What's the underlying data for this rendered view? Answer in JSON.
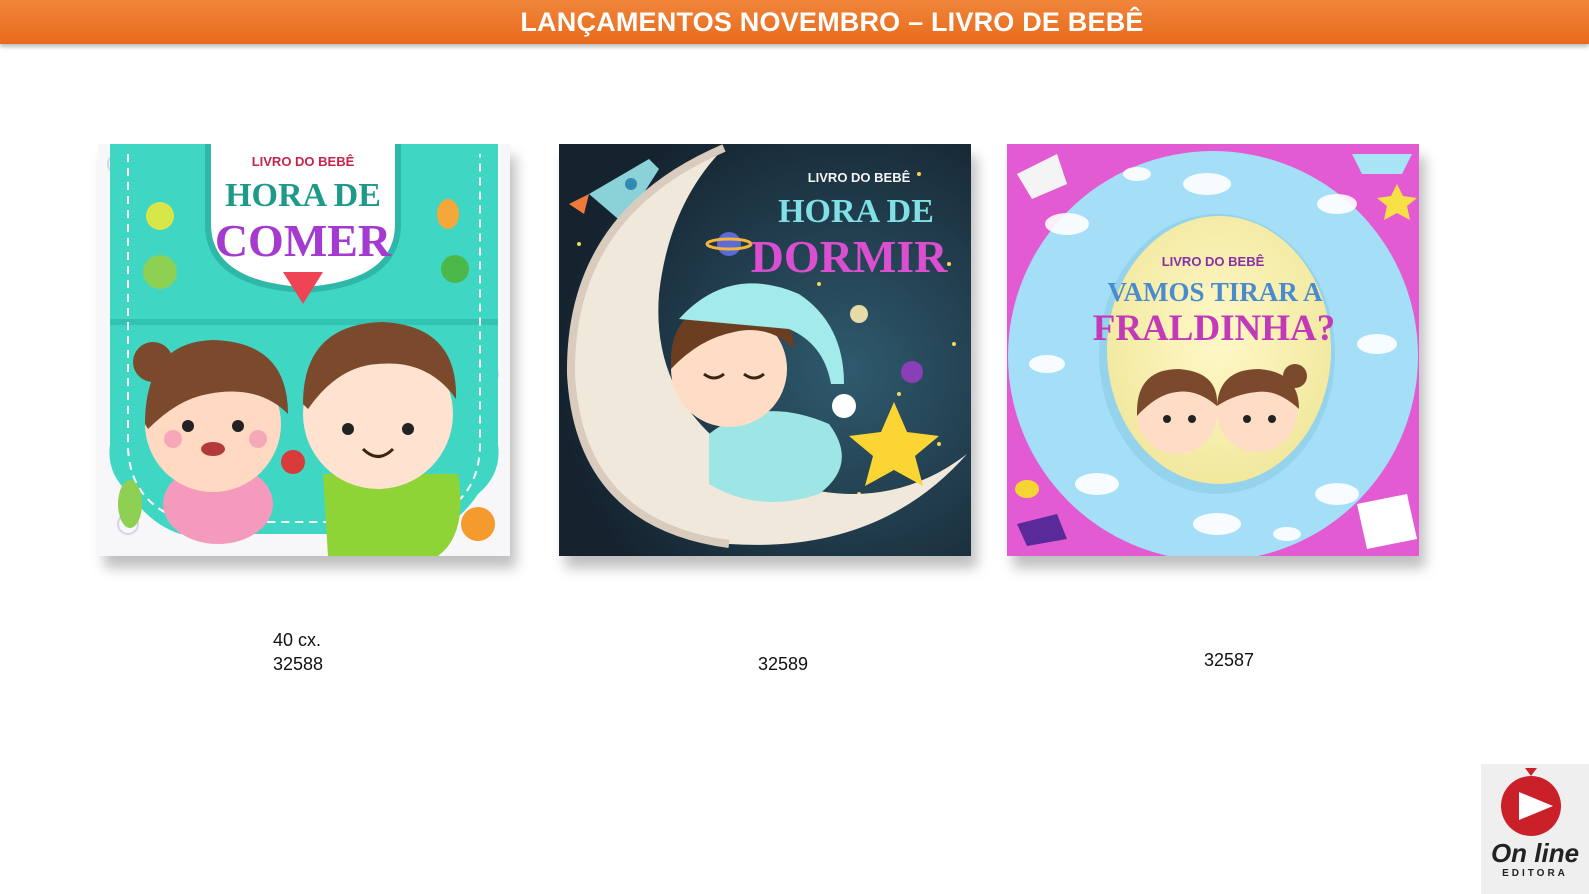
{
  "header": {
    "title": "LANÇAMENTOS NOVEMBRO – LIVRO DE BEBÊ"
  },
  "books": [
    {
      "overline": "LIVRO DO BEBÊ",
      "title_line1": "HORA DE",
      "title_line2": "COMER",
      "caption_line1": "40 cx.",
      "code": "32588"
    },
    {
      "overline": "LIVRO DO BEBÊ",
      "title_line1": "HORA DE",
      "title_line2": "DORMIR",
      "caption_line1": "",
      "code": "32589"
    },
    {
      "overline": "LIVRO DO BEBÊ",
      "title_line1": "VAMOS TIRAR A",
      "title_line2": "FRALDINHA?",
      "caption_line1": "",
      "code": "32587"
    }
  ],
  "logo": {
    "name": "On line",
    "sub": "EDITORA"
  },
  "colors": {
    "banner": "#e86b1c",
    "bib": "#3fd6c4",
    "night": "#1d3347",
    "pink": "#e35bd2",
    "sky": "#9fdcf5"
  }
}
